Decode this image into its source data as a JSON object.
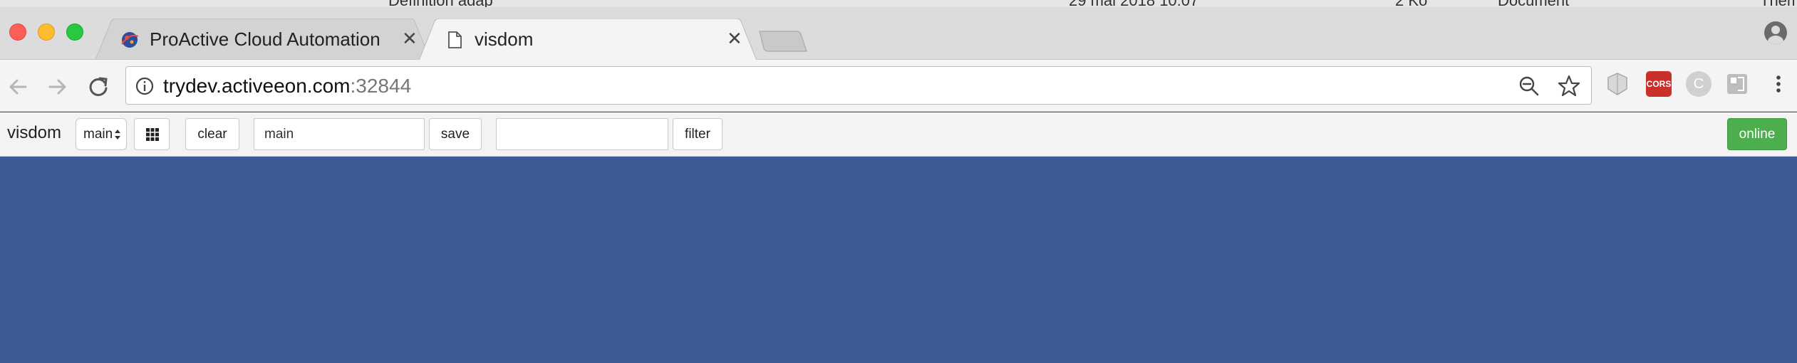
{
  "background_window": {
    "items": [
      "Définition adap",
      "29 mai 2018 10:07",
      "2 Ko",
      "Document",
      "Thème"
    ]
  },
  "browser": {
    "tabs": [
      {
        "title": "ProActive Cloud Automation | C",
        "close": "✕",
        "favicon": "globe-icon"
      },
      {
        "title": "visdom",
        "close": "✕",
        "favicon": "document-icon"
      }
    ],
    "address": {
      "host": "trydev.activeeon.com",
      "port": ":32844"
    },
    "extensions": [
      "shield-extension-icon",
      "cors-extension-icon",
      "c-extension-icon",
      "image-extension-icon"
    ],
    "cors_label": "CORS",
    "c_label": "C"
  },
  "toolbar": {
    "brand": "visdom",
    "env_select": "main",
    "clear_label": "clear",
    "env_input": "main",
    "save_label": "save",
    "filter_input": "",
    "filter_label": "filter",
    "status": "online"
  },
  "colors": {
    "workspace": "#3d5b96",
    "online": "#4cae4c",
    "cors": "#c9302c"
  }
}
